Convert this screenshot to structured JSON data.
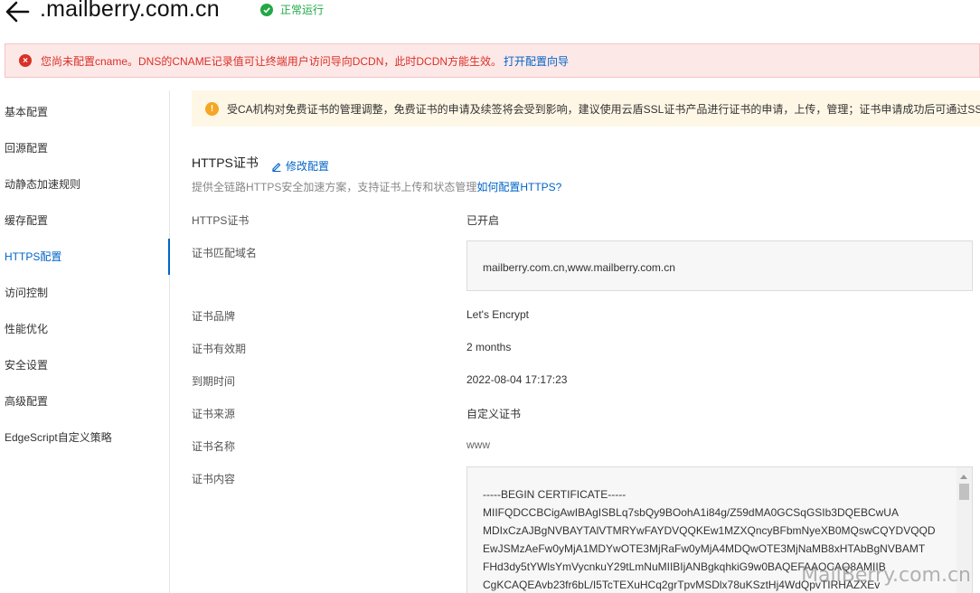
{
  "header": {
    "domain": ".mailberry.com.cn",
    "status": "正常运行"
  },
  "error_notice": {
    "text": "您尚未配置cname。DNS的CNAME记录值可让终端用户访问导向DCDN，此时DCDN方能生效。",
    "link": "打开配置向导"
  },
  "sidebar": {
    "items": [
      {
        "label": "基本配置"
      },
      {
        "label": "回源配置"
      },
      {
        "label": "动静态加速规则"
      },
      {
        "label": "缓存配置"
      },
      {
        "label": "HTTPS配置"
      },
      {
        "label": "访问控制"
      },
      {
        "label": "性能优化"
      },
      {
        "label": "安全设置"
      },
      {
        "label": "高级配置"
      },
      {
        "label": "EdgeScript自定义策略"
      }
    ],
    "active_index": 4
  },
  "warning_notice": {
    "text": "受CA机构对免费证书的管理调整，免费证书的申请及续签将会受到影响，建议使用云盾SSL证书产品进行证书的申请，上传，管理；证书申请成功后可通过SSL"
  },
  "section": {
    "title": "HTTPS证书",
    "edit_label": "修改配置",
    "desc": "提供全链路HTTPS安全加速方案，支持证书上传和状态管理",
    "desc_link": "如何配置HTTPS?"
  },
  "fields": {
    "https_cert": {
      "label": "HTTPS证书",
      "value": "已开启"
    },
    "match_domain": {
      "label": "证书匹配域名",
      "value": "mailberry.com.cn,www.mailberry.com.cn"
    },
    "brand": {
      "label": "证书品牌",
      "value": "Let's Encrypt"
    },
    "validity": {
      "label": "证书有效期",
      "value": "2 months"
    },
    "expiry": {
      "label": "到期时间",
      "value": "2022-08-04 17:17:23"
    },
    "source": {
      "label": "证书来源",
      "value": "自定义证书"
    },
    "name": {
      "label": "证书名称",
      "value": "www"
    },
    "content": {
      "label": "证书内容"
    }
  },
  "certificate": {
    "lines": [
      "-----BEGIN CERTIFICATE-----",
      "MIIFQDCCBCigAwIBAgISBLq7sbQy9BOohA1i84g/Z59dMA0GCSqGSIb3DQEBCwUA",
      "MDIxCzAJBgNVBAYTAlVTMRYwFAYDVQQKEw1MZXQncyBFbmNyeXB0MQswCQYDVQQD",
      "EwJSMzAeFw0yMjA1MDYwOTE3MjRaFw0yMjA4MDQwOTE3MjNaMB8xHTAbBgNVBAMT",
      "FHd3dy5tYWlsYmVycnkuY29tLmNuMIIBIjANBgkqhkiG9w0BAQEFAAOCAQ8AMIIB",
      "CgKCAQEAvb23fr6bL/I5TcTEXuHCq2grTpvMSDlx78uKSztHj4WdQpvTIRHAZXEv"
    ]
  },
  "watermark": "MailBerry.com.cn"
}
